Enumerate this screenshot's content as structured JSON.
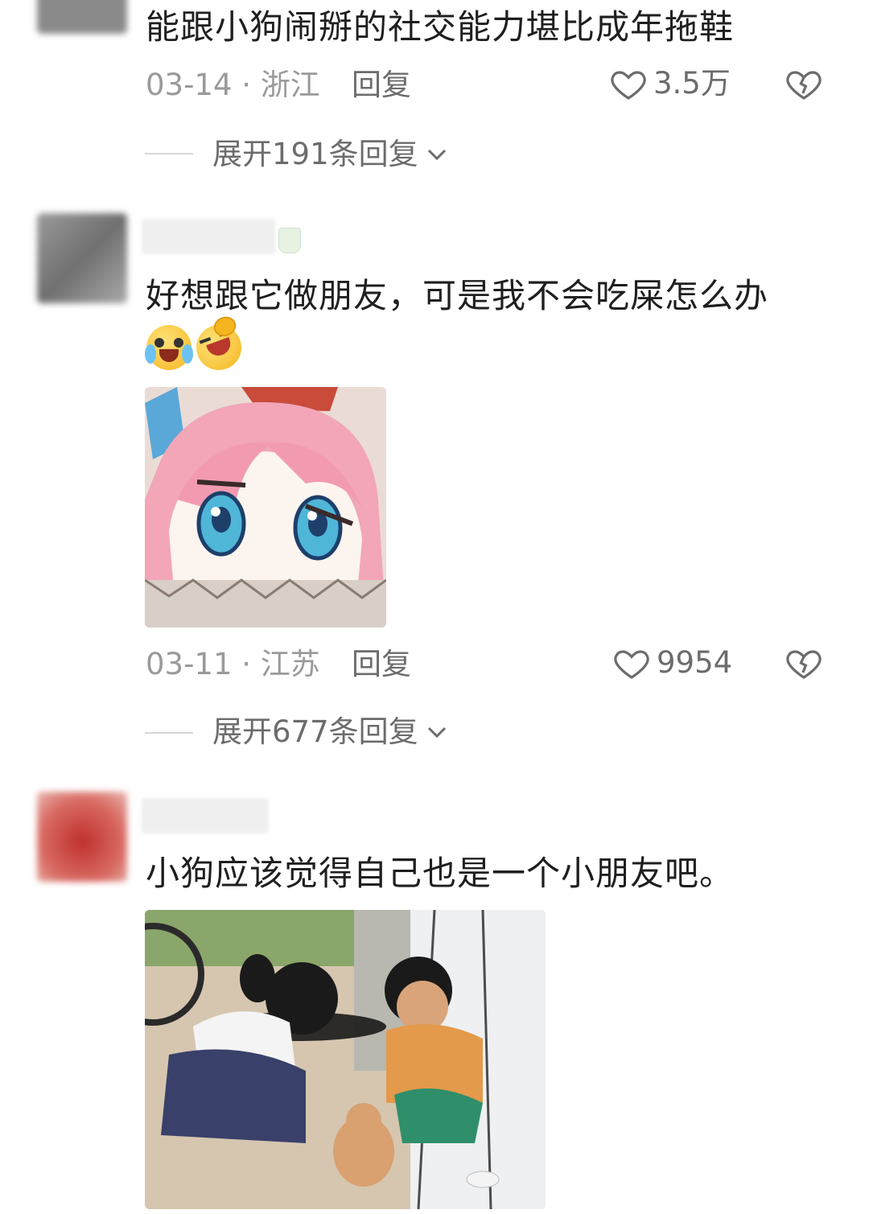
{
  "comments": [
    {
      "text": "能跟小狗闹掰的社交能力堪比成年拖鞋",
      "date": "03-14",
      "location": "浙江",
      "reply_label": "回复",
      "likes": "3.5万",
      "expand_label": "展开191条回复"
    },
    {
      "text": "好想跟它做朋友，可是我不会吃屎怎么办",
      "emojis": [
        "crying-laugh-emoji",
        "rofl-emoji"
      ],
      "image": "anime-pink-hair-girl-sticker",
      "date": "03-11",
      "location": "江苏",
      "reply_label": "回复",
      "likes": "9954",
      "expand_label": "展开677条回复"
    },
    {
      "text": "小狗应该觉得自己也是一个小朋友吧。",
      "image": "children-playing-with-puppy-photo"
    }
  ],
  "colors": {
    "text": "#1f1f1f",
    "meta": "#9a9a9a",
    "secondary": "#6c6c6c",
    "divider": "#d7d7d7"
  }
}
